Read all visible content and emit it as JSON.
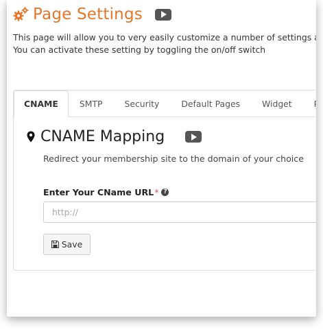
{
  "header": {
    "title": "Page Settings",
    "accent_color": "#e4772b",
    "icon": "gears-icon"
  },
  "description": {
    "line1": "This page will allow you to very easily customize a number of settings a",
    "line2": "You can activate these setting by toggling the on/off switch"
  },
  "tabs": [
    {
      "label": "CNAME",
      "active": true
    },
    {
      "label": "SMTP",
      "active": false
    },
    {
      "label": "Security",
      "active": false
    },
    {
      "label": "Default Pages",
      "active": false
    },
    {
      "label": "Widget",
      "active": false
    },
    {
      "label": "Poli",
      "active": false
    }
  ],
  "section": {
    "title": "CNAME Mapping",
    "icon": "map-marker-icon",
    "subtitle": "Redirect your membership site to the domain of your choice"
  },
  "form": {
    "field_label": "Enter Your CName URL",
    "required_mark": "*",
    "help_glyph": "?",
    "input_placeholder": "http://",
    "input_value": "",
    "save_label": "Save"
  }
}
